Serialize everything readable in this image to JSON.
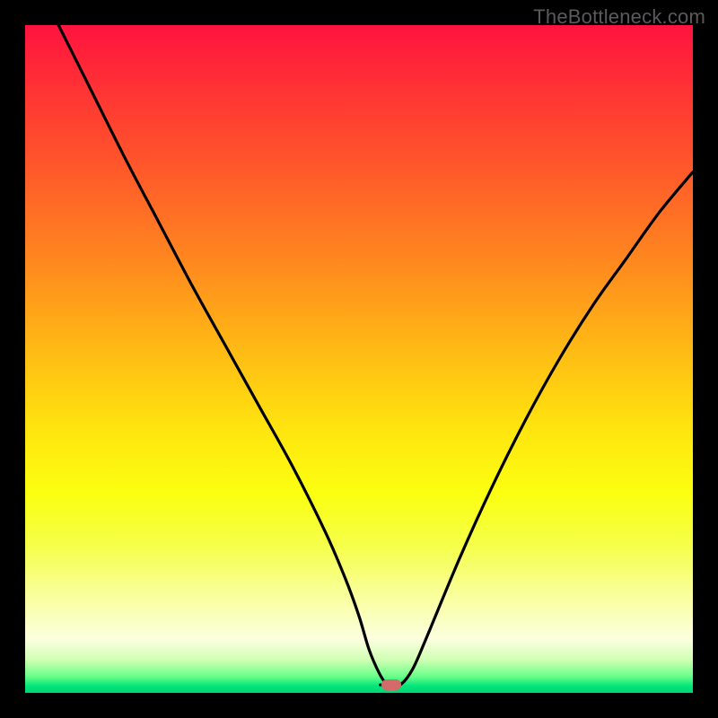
{
  "watermark": {
    "text": "TheBottleneck.com"
  },
  "chart_data": {
    "type": "line",
    "title": "",
    "xlabel": "",
    "ylabel": "",
    "xlim": [
      0,
      100
    ],
    "ylim": [
      0,
      100
    ],
    "grid": false,
    "curve": {
      "x": [
        5,
        10,
        15,
        20,
        25,
        30,
        35,
        40,
        45,
        48,
        50,
        51.5,
        53,
        54,
        54.9,
        56.3,
        58,
        60,
        65,
        70,
        75,
        80,
        85,
        90,
        95,
        100
      ],
      "y": [
        100,
        90,
        80,
        70.5,
        61,
        52,
        43,
        34,
        24,
        17,
        11.5,
        6.5,
        3,
        1.5,
        1.2,
        1.3,
        3.5,
        8,
        20,
        31,
        41,
        50,
        58,
        65,
        72,
        78
      ]
    },
    "marker": {
      "x": 54.8,
      "y": 1.2,
      "color": "#d46a6a"
    },
    "colors": {
      "curve": "#000000",
      "background_top": "#ff133f",
      "background_bottom": "#00d474",
      "frame": "#000000",
      "watermark": "#5a5a5a"
    }
  }
}
